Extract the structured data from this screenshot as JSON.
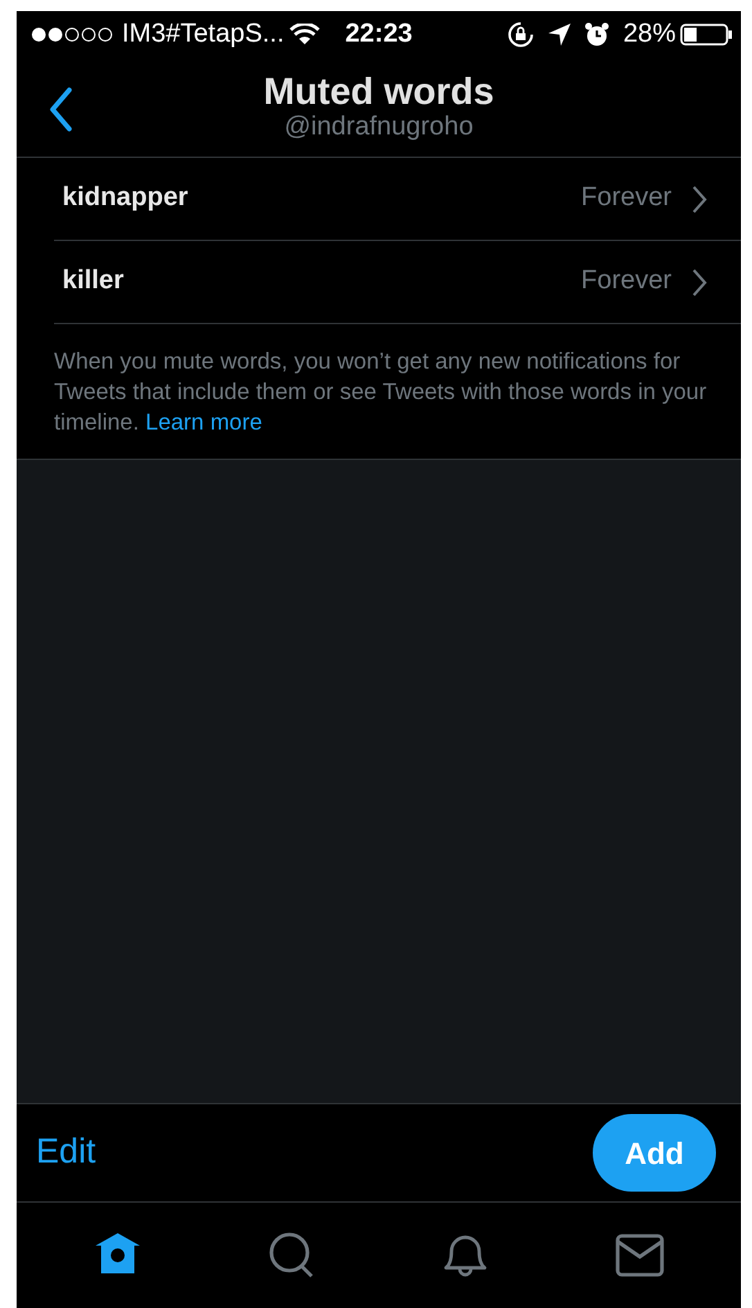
{
  "status_bar": {
    "carrier": "IM3#TetapS...",
    "time": "22:23",
    "battery": "28%"
  },
  "header": {
    "title": "Muted words",
    "subtitle": "@indrafnugroho"
  },
  "muted_words": [
    {
      "word": "kidnapper",
      "duration": "Forever"
    },
    {
      "word": "killer",
      "duration": "Forever"
    }
  ],
  "description": {
    "text": "When you mute words, you won’t get any new notifications for Tweets that include them or see Tweets with those words in your timeline.",
    "link": "Learn more"
  },
  "toolbar": {
    "edit": "Edit",
    "add": "Add"
  },
  "tab_bar": [
    {
      "kind": "home",
      "selected": true
    },
    {
      "kind": "search",
      "selected": false
    },
    {
      "kind": "notifications",
      "selected": false
    },
    {
      "kind": "messages",
      "selected": false
    }
  ]
}
